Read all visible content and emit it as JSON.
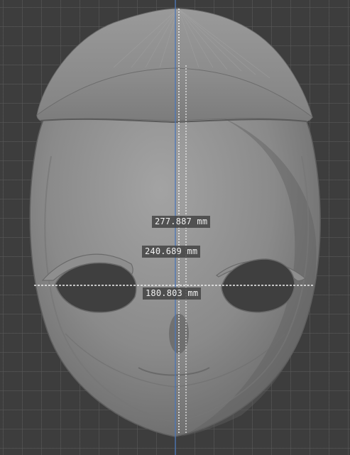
{
  "viewport": {
    "background": "#3d3d3d",
    "grid_color": "#5a5a5a",
    "axis_color": "#4a76b8"
  },
  "model": {
    "mesh_name": "face-mask-mesh",
    "colors": {
      "skin_light": "#9c9c9c",
      "skin_mid": "#868686",
      "skin_dark": "#6c6c6c",
      "cap": "#8f8f8f"
    }
  },
  "measurements": [
    {
      "label": "277.887 mm"
    },
    {
      "label": "240.689 mm"
    },
    {
      "label": "180.803 mm"
    }
  ]
}
